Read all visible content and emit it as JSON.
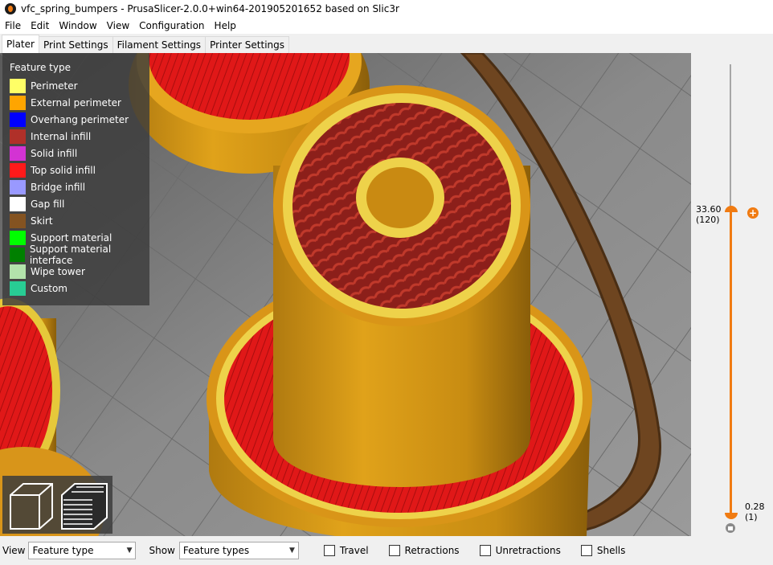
{
  "window": {
    "title": "vfc_spring_bumpers - PrusaSlicer-2.0.0+win64-201905201652 based on Slic3r"
  },
  "menu": [
    "File",
    "Edit",
    "Window",
    "View",
    "Configuration",
    "Help"
  ],
  "tabs": [
    "Plater",
    "Print Settings",
    "Filament Settings",
    "Printer Settings"
  ],
  "active_tab": "Plater",
  "legend": {
    "title": "Feature type",
    "items": [
      {
        "label": "Perimeter",
        "color": "#ffff66"
      },
      {
        "label": "External perimeter",
        "color": "#ffa500"
      },
      {
        "label": "Overhang perimeter",
        "color": "#0000ff"
      },
      {
        "label": "Internal infill",
        "color": "#b03029"
      },
      {
        "label": "Solid infill",
        "color": "#d333d3"
      },
      {
        "label": "Top solid infill",
        "color": "#ff1a1a"
      },
      {
        "label": "Bridge infill",
        "color": "#9999ff"
      },
      {
        "label": "Gap fill",
        "color": "#ffffff"
      },
      {
        "label": "Skirt",
        "color": "#845321"
      },
      {
        "label": "Support material",
        "color": "#00ff00"
      },
      {
        "label": "Support material interface",
        "color": "#008000"
      },
      {
        "label": "Wipe tower",
        "color": "#b3e3ab"
      },
      {
        "label": "Custom",
        "color": "#28cc94"
      }
    ]
  },
  "layer_slider": {
    "upper_height": "33.60",
    "upper_layer": "(120)",
    "lower_height": "0.28",
    "lower_layer": "(1)",
    "accent_color": "#f07b12"
  },
  "bottom": {
    "view_label": "View",
    "view_value": "Feature type",
    "show_label": "Show",
    "show_value": "Feature types",
    "checkboxes": [
      {
        "label": "Travel",
        "checked": false
      },
      {
        "label": "Retractions",
        "checked": false
      },
      {
        "label": "Unretractions",
        "checked": false
      },
      {
        "label": "Shells",
        "checked": false
      }
    ]
  }
}
